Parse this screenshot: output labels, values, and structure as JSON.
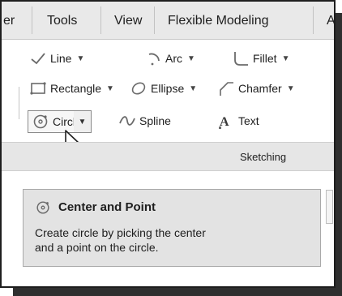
{
  "tabs": [
    {
      "label": "er"
    },
    {
      "label": "Tools"
    },
    {
      "label": "View"
    },
    {
      "label": "Flexible Modeling"
    },
    {
      "label": "A"
    }
  ],
  "ribbon": {
    "line": {
      "label": "Line",
      "icon": "line-icon"
    },
    "arc": {
      "label": "Arc",
      "icon": "arc-icon"
    },
    "fillet": {
      "label": "Fillet",
      "icon": "fillet-icon"
    },
    "rectangle": {
      "label": "Rectangle",
      "icon": "rectangle-icon"
    },
    "ellipse": {
      "label": "Ellipse",
      "icon": "ellipse-icon"
    },
    "chamfer": {
      "label": "Chamfer",
      "icon": "chamfer-icon"
    },
    "circle": {
      "label": "Circle",
      "icon": "circle-icon"
    },
    "spline": {
      "label": "Spline",
      "icon": "spline-icon"
    },
    "text": {
      "label": "Text",
      "icon": "text-icon"
    },
    "group_label": "Sketching"
  },
  "tooltip": {
    "title": "Center and Point",
    "icon": "center-point-circle-icon",
    "body_line1": "Create circle by picking the center",
    "body_line2": "and a point on the circle."
  },
  "colors": {
    "accent": "#7a7a7a",
    "tab_bar": "#e9e9e9",
    "group_bar": "#e6e6e6",
    "tooltip_bg": "#e3e3e3"
  }
}
